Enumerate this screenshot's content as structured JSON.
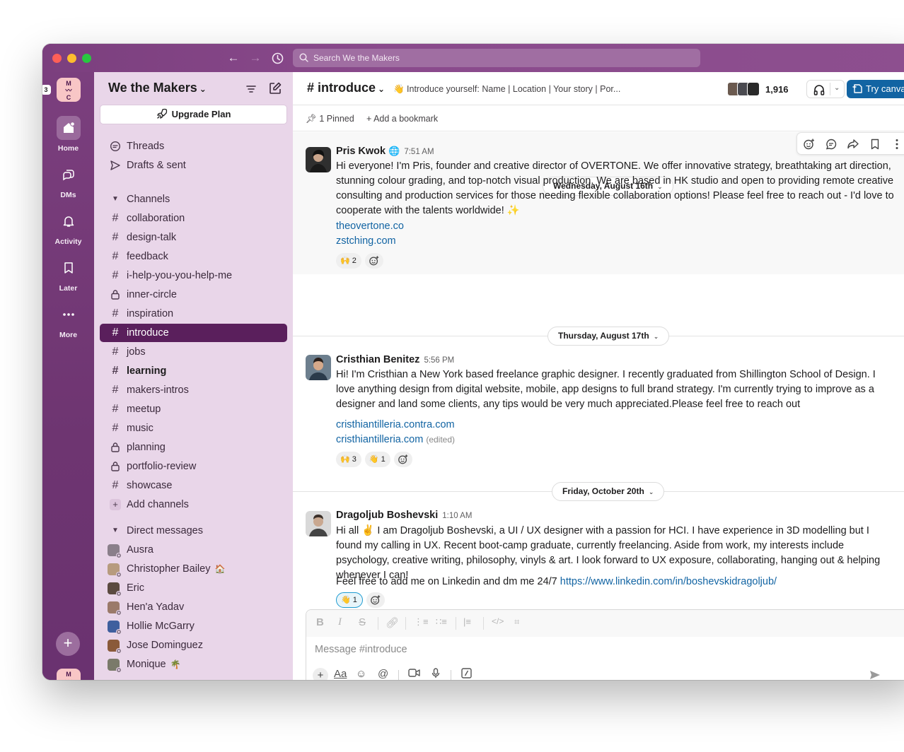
{
  "search": {
    "placeholder": "Search We the Makers"
  },
  "rail": {
    "workspace_initials": "M\n〰\nC",
    "badge": "3",
    "items": [
      {
        "label": "Home",
        "icon": "home-icon"
      },
      {
        "label": "DMs",
        "icon": "dm-icon"
      },
      {
        "label": "Activity",
        "icon": "bell-icon"
      },
      {
        "label": "Later",
        "icon": "bookmark-icon"
      },
      {
        "label": "More",
        "icon": "more-icon"
      }
    ]
  },
  "sidebar": {
    "workspace_name": "We the Makers",
    "upgrade_label": "Upgrade Plan",
    "nav": [
      {
        "label": "Threads"
      },
      {
        "label": "Drafts & sent"
      }
    ],
    "channels_header": "Channels",
    "channels": [
      {
        "label": "collaboration",
        "type": "public",
        "bold": false,
        "active": false
      },
      {
        "label": "design-talk",
        "type": "public",
        "bold": false,
        "active": false
      },
      {
        "label": "feedback",
        "type": "public",
        "bold": false,
        "active": false
      },
      {
        "label": "i-help-you-you-help-me",
        "type": "public",
        "bold": false,
        "active": false
      },
      {
        "label": "inner-circle",
        "type": "private",
        "bold": false,
        "active": false
      },
      {
        "label": "inspiration",
        "type": "public",
        "bold": false,
        "active": false
      },
      {
        "label": "introduce",
        "type": "public",
        "bold": false,
        "active": true
      },
      {
        "label": "jobs",
        "type": "public",
        "bold": false,
        "active": false
      },
      {
        "label": "learning",
        "type": "public",
        "bold": true,
        "active": false
      },
      {
        "label": "makers-intros",
        "type": "public",
        "bold": false,
        "active": false
      },
      {
        "label": "meetup",
        "type": "public",
        "bold": false,
        "active": false
      },
      {
        "label": "music",
        "type": "public",
        "bold": false,
        "active": false
      },
      {
        "label": "planning",
        "type": "private",
        "bold": false,
        "active": false
      },
      {
        "label": "portfolio-review",
        "type": "private",
        "bold": false,
        "active": false
      },
      {
        "label": "showcase",
        "type": "public",
        "bold": false,
        "active": false
      }
    ],
    "add_channels": "Add channels",
    "dm_header": "Direct messages",
    "dms": [
      {
        "label": "Ausra",
        "color": "#8a7f8a",
        "status_emoji": ""
      },
      {
        "label": "Christopher Bailey",
        "color": "#b79b7e",
        "status_emoji": "🏠"
      },
      {
        "label": "Eric",
        "color": "#5b4a40",
        "status_emoji": ""
      },
      {
        "label": "Hen'a Yadav",
        "color": "#9b7a6a",
        "status_emoji": ""
      },
      {
        "label": "Hollie McGarry",
        "color": "#3f5f9e",
        "status_emoji": ""
      },
      {
        "label": "Jose Dominguez",
        "color": "#8a5a3a",
        "status_emoji": ""
      },
      {
        "label": "Monique",
        "color": "#7a7a6a",
        "status_emoji": "🌴"
      }
    ]
  },
  "channel": {
    "name": "introduce",
    "topic": "👋 Introduce yourself: Name | Location | Your story | Por...",
    "member_count": "1,916",
    "canvas_label": "Try canva",
    "pinned": "1 Pinned",
    "add_bookmark": "Add a bookmark"
  },
  "messages": [
    {
      "date": "Wednesday, August 16th",
      "author": "Pris Kwok",
      "verified": "🌐",
      "time": "7:51 AM",
      "avatar_color": "#3a3a3a",
      "text": "Hi everyone! I'm Pris, founder and creative director of OVERTONE. We offer innovative strategy, breathtaking art direction, stunning colour grading, and top-notch visual production. We are based in HK studio and open to providing remote creative consulting and production services for those needing flexible collaboration options! Please feel free to reach out - I'd love to cooperate with the talents worldwide! ✨",
      "links": [
        "theovertone.co",
        "zstching.com"
      ],
      "reactions": [
        {
          "emoji": "🙌",
          "count": "2"
        }
      ]
    },
    {
      "date": "Thursday, August 17th",
      "author": "Cristhian Benitez",
      "time": "5:56 PM",
      "avatar_color": "#5a6a7a",
      "text": "Hi! I'm Cristhian a New York based freelance graphic designer. I recently graduated from Shillington School of Design. I love anything design from digital website, mobile, app designs to full brand strategy. I'm currently trying to improve as a designer and land some clients, any tips would be very much appreciated.Please feel free to reach out",
      "links": [
        "cristhiantilleria.contra.com",
        "cristhiantilleria.com"
      ],
      "edited": "(edited)",
      "reactions": [
        {
          "emoji": "🙌",
          "count": "3"
        },
        {
          "emoji": "👋",
          "count": "1"
        }
      ]
    },
    {
      "date": "Friday, October 20th",
      "author": "Dragoljub Boshevski",
      "time": "1:10 AM",
      "avatar_color": "#6a6a6a",
      "text": "Hi all ✌️  I am Dragoljub Boshevski, a UI / UX designer with a passion for HCI. I have experience in 3D modelling but I found my calling in UX. Recent boot-camp graduate, currently freelancing. Aside from work, my interests include psychology, creative writing, philosophy, vinyls & art. I look forward to UX exposure, collaborating, hanging out & helping whenever I can!",
      "text2": "Feel free to add me on Linkedin and dm me 24/7 ",
      "link_inline": "https://www.linkedin.com/in/boshevskidragoljub/",
      "reactions": [
        {
          "emoji": "👋",
          "count": "1"
        }
      ]
    }
  ],
  "composer": {
    "placeholder": "Message #introduce",
    "text_format_label": "Aa"
  },
  "colors": {
    "aubergine": "#4a154b",
    "sidebar": "#e9d6e9",
    "active": "#5a1f5c",
    "link": "#1264a3"
  }
}
